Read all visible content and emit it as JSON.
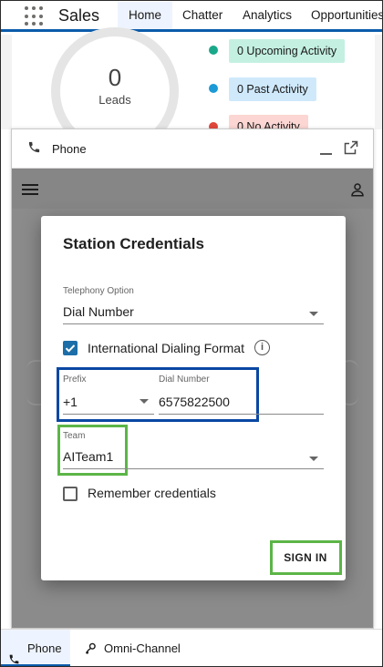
{
  "nav": {
    "app_name": "Sales",
    "tabs": [
      "Home",
      "Chatter",
      "Analytics",
      "Opportunities"
    ],
    "active_tab": "Home"
  },
  "dashboard": {
    "leads_count": "0",
    "leads_label": "Leads",
    "legend": [
      {
        "label": "0 Upcoming Activity",
        "dot_color": "#1aa88a",
        "bg_color": "#c4f0e2"
      },
      {
        "label": "0 Past Activity",
        "dot_color": "#1b9ad6",
        "bg_color": "#cfe9fb"
      },
      {
        "label": "0 No Activity",
        "dot_color": "#e0463b",
        "bg_color": "#fbd6d2"
      }
    ]
  },
  "phone_panel": {
    "title": "Phone",
    "dialog": {
      "title": "Station Credentials",
      "telephony_label": "Telephony Option",
      "telephony_value": "Dial Number",
      "intl_format_label": "International Dialing Format",
      "intl_format_checked": true,
      "prefix_label": "Prefix",
      "prefix_value": "+1",
      "dial_number_label": "Dial Number",
      "dial_number_value": "6575822500",
      "team_label": "Team",
      "team_value": "AITeam1",
      "remember_label": "Remember credentials",
      "remember_checked": false,
      "signin_label": "SIGN IN"
    }
  },
  "utility_bar": {
    "items": [
      "Phone",
      "Omni-Channel"
    ],
    "active_item": "Phone"
  },
  "colors": {
    "brand_blue": "#0b5cab",
    "highlight_blue": "#0a47a3",
    "highlight_green": "#5cb547",
    "checkbox_blue": "#1b6ea8"
  },
  "icons": [
    "app-launcher-icon",
    "phone-icon",
    "minimize-icon",
    "popout-icon",
    "hamburger-menu-icon",
    "user-icon",
    "info-icon",
    "omni-channel-icon"
  ]
}
